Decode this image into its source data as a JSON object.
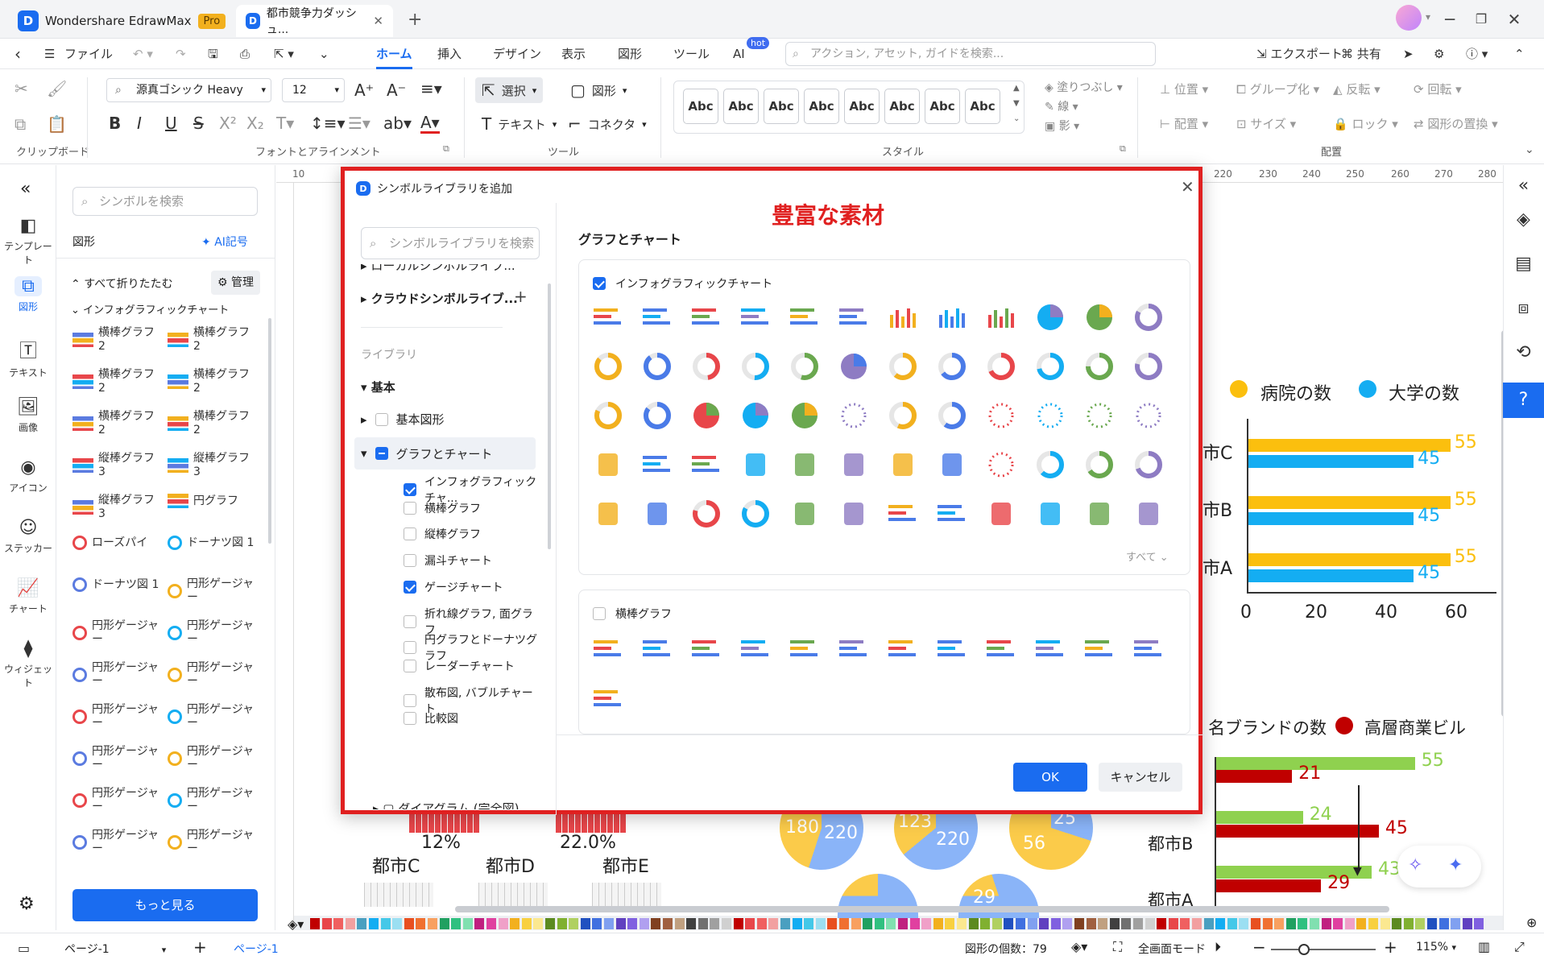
{
  "app": {
    "title": "Wondershare EdrawMax",
    "badge": "Pro",
    "doc_tab": "都市競争力ダッシュ..."
  },
  "menu": {
    "file": "ファイル",
    "items": [
      "ホーム",
      "挿入",
      "デザイン",
      "表示",
      "図形",
      "ツール",
      "AI"
    ],
    "hot": "hot",
    "search_placeholder": "アクション, アセット, ガイドを検索...",
    "export": "エクスポート",
    "share": "共有"
  },
  "ribbon": {
    "font_name": "源真ゴシック Heavy",
    "font_size": "12",
    "select": "選択",
    "shape": "図形",
    "text": "テキスト",
    "connector": "コネクタ",
    "abc": [
      "Abc",
      "Abc",
      "Abc",
      "Abc",
      "Abc",
      "Abc",
      "Abc",
      "Abc"
    ],
    "fill": "塗りつぶし",
    "line": "線",
    "shadow": "影",
    "position": "位置",
    "group": "グループ化",
    "flip": "反転",
    "rotate": "回転",
    "align": "配置",
    "size": "サイズ",
    "lock": "ロック",
    "replace": "図形の置換",
    "groups": [
      "クリップボード",
      "フォントとアラインメント",
      "ツール",
      "スタイル",
      "配置"
    ]
  },
  "leftbar": [
    "テンプレート",
    "図形",
    "テキスト",
    "画像",
    "アイコン",
    "ステッカー",
    "チャート",
    "ウィジェット"
  ],
  "library": {
    "search": "シンボルを検索",
    "title": "図形",
    "ai": "AI記号",
    "collapse": "すべて折りたたむ",
    "manage": "管理",
    "section": "インフォグラフィックチャート",
    "items": [
      [
        "横棒グラフ 2",
        "横棒グラフ 2"
      ],
      [
        "横棒グラフ 2",
        "横棒グラフ 2"
      ],
      [
        "横棒グラフ 2",
        "横棒グラフ 2"
      ],
      [
        "縦棒グラフ 3",
        "縦棒グラフ 3"
      ],
      [
        "縦棒グラフ 3",
        "円グラフ"
      ],
      [
        "ローズパイ",
        "ドーナツ図 1"
      ],
      [
        "ドーナツ図 1",
        "円形ゲージャー"
      ],
      [
        "円形ゲージャー",
        "円形ゲージャー"
      ],
      [
        "円形ゲージャー",
        "円形ゲージャー"
      ],
      [
        "円形ゲージャー",
        "円形ゲージャー"
      ],
      [
        "円形ゲージャー",
        "円形ゲージャー"
      ],
      [
        "円形ゲージャー",
        "円形ゲージャー"
      ],
      [
        "円形ゲージャー",
        "円形ゲージャー"
      ]
    ],
    "more": "もっと見る"
  },
  "dialog": {
    "title": "シンボルライブラリを追加",
    "banner": "豊富な素材",
    "search": "シンボルライブラリを検索",
    "local": "ローカルシンボルライブ...",
    "cloud": "クラウドシンボルライブ...",
    "library_label": "ライブラリ",
    "basic": "基本",
    "basic_shapes": "基本図形",
    "graphs": "グラフとチャート",
    "children": [
      "インフォグラフィックチャ...",
      "横棒グラフ",
      "縦棒グラフ",
      "漏斗チャート",
      "ゲージチャート",
      "折れ線グラフ, 面グラフ",
      "円グラフとドーナツグラフ",
      "レーダーチャート",
      "散布図, バブルチャート",
      "比較図"
    ],
    "section_title": "グラフとチャート",
    "panel1": "インフォグラフィックチャート",
    "see_all": "すべて",
    "panel2": "横棒グラフ",
    "ok": "OK",
    "cancel": "キャンセル"
  },
  "canvas": {
    "legend1": [
      "病院の数",
      "大学の数"
    ],
    "cities": [
      "市C",
      "市B",
      "市A"
    ],
    "vals1": [
      "55",
      "45"
    ],
    "axis1": [
      "0",
      "20",
      "40",
      "60"
    ],
    "legend2": [
      "名ブランドの数",
      "高層商業ビル"
    ],
    "vals2": [
      "55",
      "21",
      "24",
      "45",
      "43",
      "29"
    ],
    "city2": [
      "都市B",
      "都市A"
    ],
    "bottom": [
      "12%",
      "22.0%",
      "都市C",
      "都市D",
      "都市E"
    ],
    "pie": [
      "180",
      "220",
      "123",
      "220",
      "25",
      "56",
      "29"
    ]
  },
  "colors": {
    "accent": "#1a6cf0",
    "red": "#e02020",
    "yellow": "#fbbf0e",
    "blue": "#14adf2",
    "green": "#8fd14f",
    "darkred": "#c00000"
  },
  "status": {
    "page_sel": "ページ-1",
    "page_tab": "ページ-1",
    "count": "図形の個数：79",
    "fullscreen": "全画面モード",
    "zoom": "115%"
  }
}
